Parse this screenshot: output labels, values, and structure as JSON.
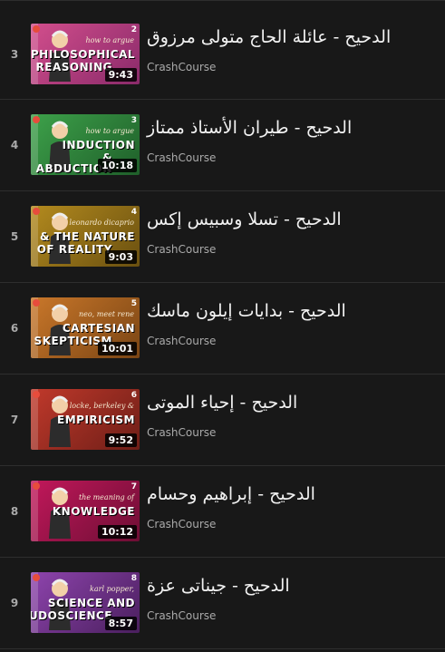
{
  "playlist": {
    "items": [
      {
        "index": "3",
        "title": "الدحيح - عائلة الحاج متولى مرزوق",
        "channel": "CrashCourse",
        "duration": "9:43",
        "thumb": {
          "num": "2",
          "sub": "how to argue",
          "big": [
            "PHILOSOPHICAL",
            "REASONING"
          ],
          "bg": "#d24e8c",
          "bg2": "#8a2a6a"
        }
      },
      {
        "index": "4",
        "title": "الدحيح - طيران الأستاذ ممتاز",
        "channel": "CrashCourse",
        "duration": "10:18",
        "thumb": {
          "num": "3",
          "sub": "how to argue",
          "big": [
            "INDUCTION",
            "& ABDUCTION"
          ],
          "bg": "#3da14a",
          "bg2": "#1f5f2a"
        }
      },
      {
        "index": "5",
        "title": "الدحيح - تسلا وسبيس إكس",
        "channel": "CrashCourse",
        "duration": "9:03",
        "thumb": {
          "num": "4",
          "sub": "leonardo dicaprio",
          "big": [
            "& THE NATURE",
            "OF REALITY"
          ],
          "bg": "#b38a1e",
          "bg2": "#6a5010"
        }
      },
      {
        "index": "6",
        "title": "الدحيح - بدايات إيلون ماسك",
        "channel": "CrashCourse",
        "duration": "10:01",
        "thumb": {
          "num": "5",
          "sub": "neo, meet rene",
          "big": [
            "CARTESIAN",
            "SKEPTICISM"
          ],
          "bg": "#c9772a",
          "bg2": "#7a4514"
        }
      },
      {
        "index": "7",
        "title": "الدحيح - إحياء الموتى",
        "channel": "CrashCourse",
        "duration": "9:52",
        "thumb": {
          "num": "6",
          "sub": "locke, berkeley &",
          "big": [
            "EMPIRICISM",
            ""
          ],
          "bg": "#c0392b",
          "bg2": "#6e1e17"
        }
      },
      {
        "index": "8",
        "title": "الدحيح - إبراهيم وحسام",
        "channel": "CrashCourse",
        "duration": "10:12",
        "thumb": {
          "num": "7",
          "sub": "the meaning of",
          "big": [
            "KNOWLEDGE",
            ""
          ],
          "bg": "#c2185b",
          "bg2": "#6d0e34"
        }
      },
      {
        "index": "9",
        "title": "الدحيح - جيناتى عزة",
        "channel": "CrashCourse",
        "duration": "8:57",
        "thumb": {
          "num": "8",
          "sub": "karl popper,",
          "big": [
            "SCIENCE AND",
            "PSEUDOSCIENCE"
          ],
          "bg": "#8e44ad",
          "bg2": "#4a1f5e"
        }
      }
    ]
  }
}
